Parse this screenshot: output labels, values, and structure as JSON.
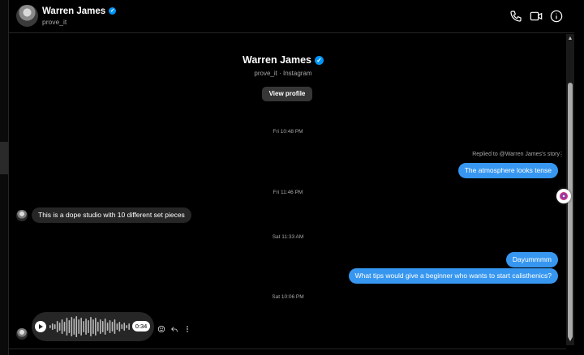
{
  "header": {
    "name": "Warren James",
    "username": "prove_it",
    "icons": [
      "phone-icon",
      "video-camera-icon",
      "info-icon"
    ]
  },
  "profile": {
    "name": "Warren James",
    "subtitle": "prove_it · Instagram",
    "view_profile_label": "View profile"
  },
  "messages": {
    "stamp1": "Fri 10:48 PM",
    "reply_note": "Replied to @Warren James's story",
    "reply_menu": "⋮",
    "out1": "The atmosphere looks tense",
    "stamp2": "Fri 11:46 PM",
    "in1": "This is a dope studio with 10 different set pieces",
    "stamp3": "Sat 11:33 AM",
    "out2": "Dayummmm",
    "out3": "What tips would give a beginner who wants to start calisthenics?",
    "stamp4": "Sat 10:06 PM",
    "voice_duration": "0:34"
  },
  "colors": {
    "accent": "#3797f0",
    "verified": "#0095f6",
    "incoming_bubble": "#262626",
    "background": "#000000"
  }
}
